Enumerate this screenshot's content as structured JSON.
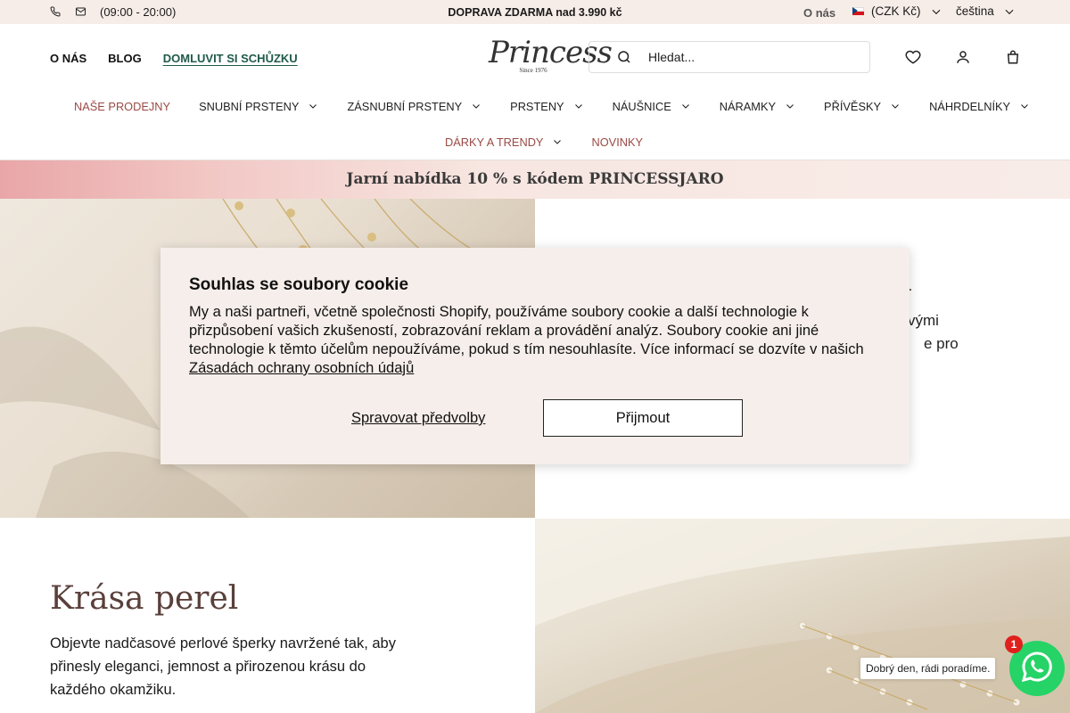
{
  "topbar": {
    "hours": "(09:00 - 20:00)",
    "shipping": "DOPRAVA ZDARMA nad 3.990 kč",
    "about": "O nás",
    "currency": "(CZK Kč)",
    "language": "čeština"
  },
  "header": {
    "nav_about": "O NÁS",
    "nav_blog": "BLOG",
    "nav_meeting": "DOMLUVIT SI SCHŮZKU",
    "logo_name": "Princess",
    "logo_since": "Since 1976",
    "search_placeholder": "Hledat..."
  },
  "menu": {
    "row1": [
      {
        "label": "NAŠE PRODEJNY",
        "dropdown": false,
        "accent": true
      },
      {
        "label": "SNUBNÍ PRSTENY",
        "dropdown": true,
        "accent": false
      },
      {
        "label": "ZÁSNUBNÍ PRSTENY",
        "dropdown": true,
        "accent": false
      },
      {
        "label": "PRSTENY",
        "dropdown": true,
        "accent": false
      },
      {
        "label": "NÁUŠNICE",
        "dropdown": true,
        "accent": false
      },
      {
        "label": "NÁRAMKY",
        "dropdown": true,
        "accent": false
      },
      {
        "label": "PŘÍVĚSKY",
        "dropdown": true,
        "accent": false
      },
      {
        "label": "NÁHRDELNÍKY",
        "dropdown": true,
        "accent": false
      }
    ],
    "row2": [
      {
        "label": "DÁRKY A TRENDY",
        "dropdown": true,
        "accent": true
      },
      {
        "label": "NOVINKY",
        "dropdown": false,
        "accent": true
      }
    ]
  },
  "promo": {
    "text": "Jarní nabídka 10 % s kódem PRINCESSJARO"
  },
  "section1": {
    "partial_heading": "l",
    "partial_line1": "vými",
    "partial_line2": "e pro"
  },
  "section2": {
    "heading": "Krása perel",
    "text": "Objevte nadčasové perlové šperky navržené tak, aby přinesly eleganci, jemnost a přirozenou krásu do každého okamžiku."
  },
  "cookie": {
    "title": "Souhlas se soubory cookie",
    "body": "My a naši partneři, včetně společnosti Shopify, používáme soubory cookie a další technologie k přizpůsobení vašich zkušeností, zobrazování reklam a provádění analýz. Soubory cookie ani jiné technologie k těmto účelům nepoužíváme, pokud s tím nesouhlasíte. Více informací se dozvíte v našich",
    "link": "Zásadách ochrany osobních údajů",
    "manage": "Spravovat předvolby",
    "accept": "Přijmout"
  },
  "whatsapp": {
    "message": "Dobrý den, rádi poradíme.",
    "badge": "1"
  },
  "colors": {
    "accent": "#9a4a45",
    "meeting_link": "#1f5a4a",
    "whatsapp": "#25d366"
  },
  "icons": [
    "phone-icon",
    "mail-icon",
    "flag-cz-icon",
    "chevron-down-icon",
    "search-icon",
    "heart-icon",
    "user-icon",
    "bag-icon",
    "whatsapp-icon"
  ]
}
